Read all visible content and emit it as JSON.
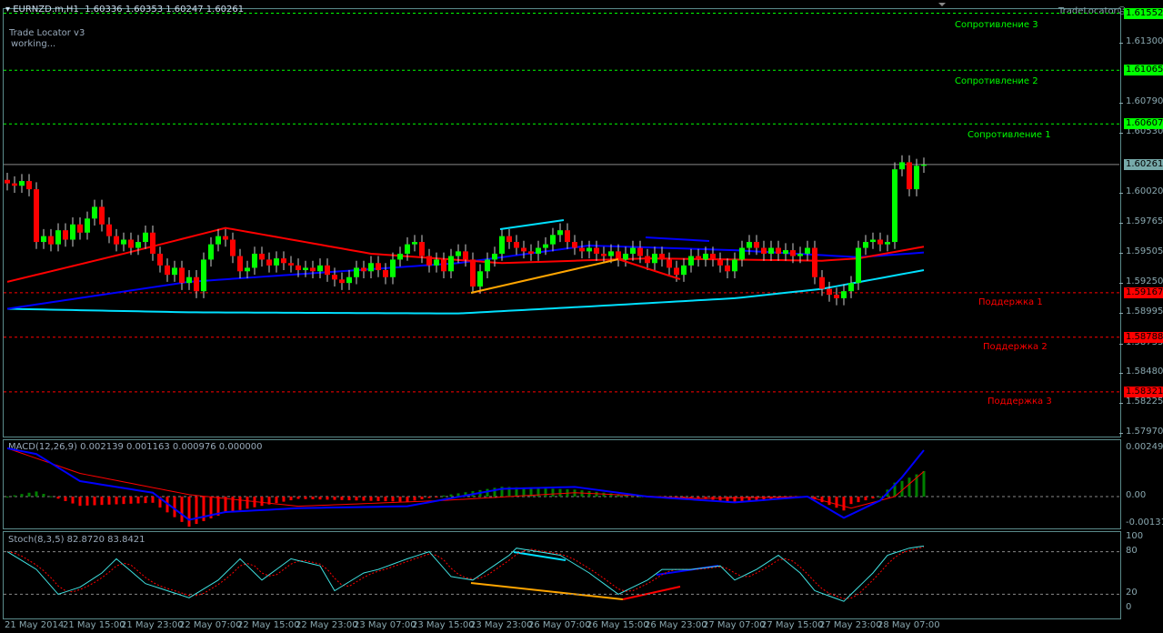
{
  "header": {
    "symbol": "EURNZD.m,H1",
    "ohlc": "1.60336 1.60353 1.60247 1.60261",
    "indicator_name": "Trade Locator v3",
    "indicator_status": "working...",
    "brand": "TradeLocator"
  },
  "price_axis": {
    "ticks": [
      "1.61300",
      "1.60790",
      "1.60530",
      "1.60020",
      "1.59765",
      "1.59505",
      "1.59250",
      "1.58995",
      "1.58735",
      "1.58480",
      "1.58225",
      "1.57970"
    ],
    "current": "1.60261"
  },
  "levels": [
    {
      "label": "Сопротивление 3",
      "price": "1.61552",
      "kind": "resistance"
    },
    {
      "label": "Сопротивление 2",
      "price": "1.61065",
      "kind": "resistance"
    },
    {
      "label": "Сопротивление 1",
      "price": "1.60607",
      "kind": "resistance"
    },
    {
      "label": "Поддержка 1",
      "price": "1.59167",
      "kind": "support"
    },
    {
      "label": "Поддержка 2",
      "price": "1.58788",
      "kind": "support"
    },
    {
      "label": "Поддержка 3",
      "price": "1.58321",
      "kind": "support"
    }
  ],
  "colors": {
    "bull": "#00ff00",
    "bear": "#ff0000",
    "resistance": "#00ff00",
    "support": "#ff0000",
    "ma_fast": "#ff0000",
    "ma_mid": "#0000ff",
    "ma_slow": "#00e0ff"
  },
  "closes": [
    1.601,
    1.6008,
    1.6012,
    1.6005,
    1.596,
    1.5965,
    1.5958,
    1.597,
    1.5962,
    1.5975,
    1.5968,
    1.598,
    1.599,
    1.5975,
    1.5965,
    1.5958,
    1.5962,
    1.5955,
    1.596,
    1.5968,
    1.595,
    1.594,
    1.5932,
    1.5938,
    1.5925,
    1.593,
    1.5918,
    1.5945,
    1.5958,
    1.5965,
    1.5962,
    1.5948,
    1.5935,
    1.5938,
    1.595,
    1.5945,
    1.594,
    1.5946,
    1.5942,
    1.594,
    1.5936,
    1.5938,
    1.5935,
    1.594,
    1.5932,
    1.5928,
    1.5925,
    1.593,
    1.5938,
    1.5935,
    1.5942,
    1.5936,
    1.593,
    1.5945,
    1.595,
    1.5958,
    1.596,
    1.5948,
    1.594,
    1.5945,
    1.5935,
    1.5948,
    1.5952,
    1.5945,
    1.5922,
    1.5935,
    1.5945,
    1.595,
    1.5965,
    1.596,
    1.5955,
    1.5952,
    1.595,
    1.5955,
    1.5958,
    1.5966,
    1.597,
    1.596,
    1.5955,
    1.5952,
    1.5955,
    1.595,
    1.5948,
    1.5952,
    1.5945,
    1.595,
    1.5955,
    1.5948,
    1.5942,
    1.595,
    1.5945,
    1.5938,
    1.5932,
    1.594,
    1.5948,
    1.5945,
    1.595,
    1.5945,
    1.594,
    1.5935,
    1.5945,
    1.5955,
    1.596,
    1.5955,
    1.595,
    1.5955,
    1.595,
    1.5953,
    1.5948,
    1.595,
    1.5955,
    1.593,
    1.592,
    1.5915,
    1.5912,
    1.5918,
    1.5925,
    1.5955,
    1.596,
    1.5962,
    1.5958,
    1.596,
    1.6022,
    1.6028,
    1.6005,
    1.6025,
    1.6026
  ],
  "ma_fast": [
    [
      0,
      1.5926
    ],
    [
      16,
      1.595
    ],
    [
      30,
      1.5972
    ],
    [
      50,
      1.595
    ],
    [
      68,
      1.5942
    ],
    [
      88,
      1.5946
    ],
    [
      112,
      1.5944
    ],
    [
      117,
      1.5946
    ],
    [
      126,
      1.5956
    ]
  ],
  "ma_mid": [
    [
      0,
      1.5903
    ],
    [
      25,
      1.5926
    ],
    [
      62,
      1.5942
    ],
    [
      80,
      1.5957
    ],
    [
      100,
      1.5953
    ],
    [
      117,
      1.5947
    ],
    [
      126,
      1.5951
    ]
  ],
  "ma_slow": [
    [
      0,
      1.5903
    ],
    [
      25,
      1.59
    ],
    [
      62,
      1.5899
    ],
    [
      80,
      1.5905
    ],
    [
      100,
      1.5912
    ],
    [
      112,
      1.592
    ],
    [
      126,
      1.5936
    ]
  ],
  "macd": {
    "label": "MACD(12,26,9) 0.002139 0.001163 0.000976 0.000000",
    "ticks": [
      "0.002494",
      "0.00",
      "-0.001314"
    ],
    "main": [
      [
        0,
        0.0025
      ],
      [
        4,
        0.0022
      ],
      [
        10,
        0.0008
      ],
      [
        20,
        0.0002
      ],
      [
        25,
        -0.0012
      ],
      [
        30,
        -0.0008
      ],
      [
        40,
        -0.0006
      ],
      [
        55,
        -0.0005
      ],
      [
        68,
        0.0004
      ],
      [
        78,
        0.0005
      ],
      [
        88,
        0.0
      ],
      [
        100,
        -0.0003
      ],
      [
        110,
        0.0
      ],
      [
        115,
        -0.0011
      ],
      [
        120,
        -0.0002
      ],
      [
        123,
        0.001
      ],
      [
        126,
        0.0024
      ]
    ],
    "signal": [
      [
        0,
        0.0025
      ],
      [
        10,
        0.0012
      ],
      [
        25,
        0.0001
      ],
      [
        40,
        -0.0005
      ],
      [
        60,
        -0.0002
      ],
      [
        78,
        0.0002
      ],
      [
        95,
        -0.0001
      ],
      [
        110,
        0.0
      ],
      [
        116,
        -0.0006
      ],
      [
        122,
        0.0
      ],
      [
        126,
        0.0013
      ]
    ]
  },
  "stoch": {
    "label": "Stoch(8,3,5) 82.8720 83.8421",
    "ticks": [
      "100",
      "80",
      "20",
      "0"
    ],
    "main": [
      [
        0,
        80
      ],
      [
        4,
        55
      ],
      [
        7,
        20
      ],
      [
        10,
        30
      ],
      [
        13,
        50
      ],
      [
        15,
        70
      ],
      [
        19,
        35
      ],
      [
        22,
        25
      ],
      [
        25,
        15
      ],
      [
        29,
        40
      ],
      [
        32,
        70
      ],
      [
        35,
        40
      ],
      [
        39,
        70
      ],
      [
        43,
        60
      ],
      [
        45,
        25
      ],
      [
        49,
        50
      ],
      [
        51,
        55
      ],
      [
        55,
        70
      ],
      [
        58,
        80
      ],
      [
        61,
        45
      ],
      [
        64,
        40
      ],
      [
        69,
        75
      ],
      [
        70,
        85
      ],
      [
        76,
        75
      ],
      [
        80,
        50
      ],
      [
        84,
        20
      ],
      [
        88,
        40
      ],
      [
        90,
        55
      ],
      [
        94,
        55
      ],
      [
        98,
        60
      ],
      [
        100,
        40
      ],
      [
        103,
        55
      ],
      [
        106,
        75
      ],
      [
        109,
        50
      ],
      [
        111,
        25
      ],
      [
        115,
        10
      ],
      [
        119,
        50
      ],
      [
        121,
        75
      ],
      [
        124,
        85
      ],
      [
        126,
        88
      ]
    ]
  },
  "time_axis": [
    "21 May 2014",
    "21 May 15:00",
    "21 May 23:00",
    "22 May 07:00",
    "22 May 15:00",
    "22 May 23:00",
    "23 May 07:00",
    "23 May 15:00",
    "23 May 23:00",
    "26 May 07:00",
    "26 May 15:00",
    "26 May 23:00",
    "27 May 07:00",
    "27 May 15:00",
    "27 May 23:00",
    "28 May 07:00"
  ]
}
